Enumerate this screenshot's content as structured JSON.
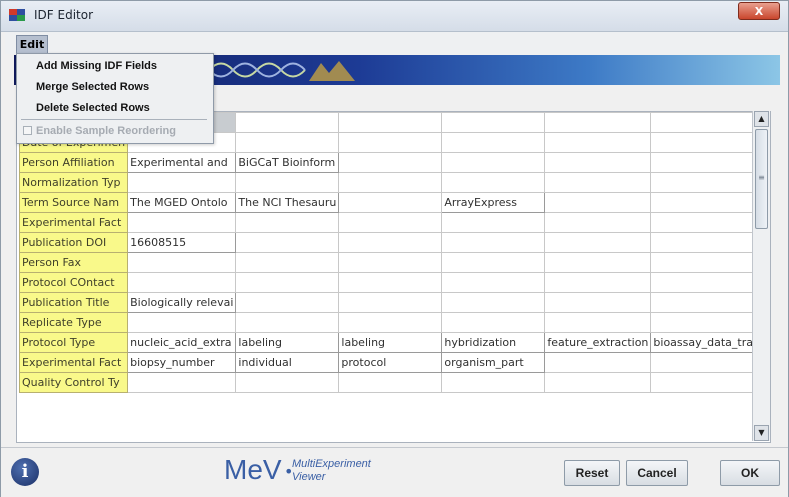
{
  "window": {
    "title": "IDF Editor",
    "close_label": "X"
  },
  "menubar": {
    "edit_label": "Edit"
  },
  "edit_menu": {
    "items": [
      "Add Missing IDF Fields",
      "Merge Selected Rows",
      "Delete Selected Rows"
    ],
    "checkbox_item": {
      "label": "Enable Sample Reordering",
      "checked": false,
      "enabled": false
    }
  },
  "grid": {
    "rows": [
      {
        "field": "",
        "values": [
          "",
          "",
          "",
          "",
          "",
          ""
        ]
      },
      {
        "field": "Date of Experimen",
        "values": [
          "",
          "",
          "",
          "",
          "",
          ""
        ]
      },
      {
        "field": "Person Affiliation",
        "values": [
          "Experimental and",
          "BiGCaT Bioinform",
          "",
          "",
          "",
          ""
        ]
      },
      {
        "field": "Normalization Typ",
        "values": [
          "",
          "",
          "",
          "",
          "",
          ""
        ]
      },
      {
        "field": "Term Source Nam",
        "values": [
          "The MGED Ontolo",
          "The NCI Thesauru",
          "",
          "ArrayExpress",
          "",
          ""
        ]
      },
      {
        "field": "Experimental Fact",
        "values": [
          "",
          "",
          "",
          "",
          "",
          ""
        ]
      },
      {
        "field": "Publication DOI",
        "values": [
          "16608515",
          "",
          "",
          "",
          "",
          ""
        ]
      },
      {
        "field": "Person Fax",
        "values": [
          "",
          "",
          "",
          "",
          "",
          ""
        ]
      },
      {
        "field": "Protocol COntact",
        "values": [
          "",
          "",
          "",
          "",
          "",
          ""
        ]
      },
      {
        "field": "Publication Title",
        "values": [
          "Biologically relevai",
          "",
          "",
          "",
          "",
          ""
        ]
      },
      {
        "field": "Replicate Type",
        "values": [
          "",
          "",
          "",
          "",
          "",
          ""
        ]
      },
      {
        "field": "Protocol Type",
        "values": [
          "nucleic_acid_extra",
          "labeling",
          "labeling",
          "hybridization",
          "feature_extraction",
          "bioassay_data_tra"
        ]
      },
      {
        "field": "Experimental Fact",
        "values": [
          "biopsy_number",
          "individual",
          "protocol",
          "organism_part",
          "",
          ""
        ]
      },
      {
        "field": "Quality Control Ty",
        "values": [
          "",
          "",
          "",
          "",
          "",
          ""
        ]
      }
    ]
  },
  "scrollbar": {
    "up_icon": "▲",
    "down_icon": "▼",
    "grip_icon": "≡"
  },
  "footer": {
    "logo_main": "MeV",
    "logo_dot": "•",
    "logo_sub_line1": "MultiExperiment",
    "logo_sub_line2": "Viewer",
    "info_glyph": "i",
    "reset_label": "Reset",
    "cancel_label": "Cancel",
    "ok_label": "OK"
  },
  "colors": {
    "field_header_bg": "#f9f98a",
    "banner_dark": "#101a5c",
    "logo_blue": "#3a5fa5",
    "menu_selected": "#b5bfcf"
  }
}
